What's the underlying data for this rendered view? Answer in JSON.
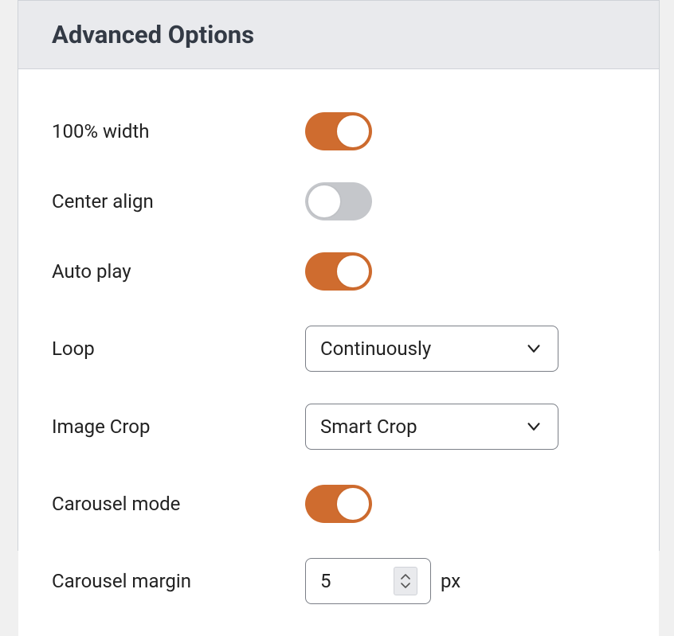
{
  "section": {
    "title": "Advanced Options"
  },
  "options": {
    "full_width": {
      "label": "100% width",
      "value": true
    },
    "center_align": {
      "label": "Center align",
      "value": false
    },
    "auto_play": {
      "label": "Auto play",
      "value": true
    },
    "loop": {
      "label": "Loop",
      "selected": "Continuously"
    },
    "image_crop": {
      "label": "Image Crop",
      "selected": "Smart Crop"
    },
    "carousel_mode": {
      "label": "Carousel mode",
      "value": true
    },
    "carousel_margin": {
      "label": "Carousel margin",
      "value": "5",
      "unit": "px"
    }
  },
  "colors": {
    "accent": "#cf6c2f",
    "toggle_off": "#c5c7cb",
    "border": "#7b7f87"
  }
}
